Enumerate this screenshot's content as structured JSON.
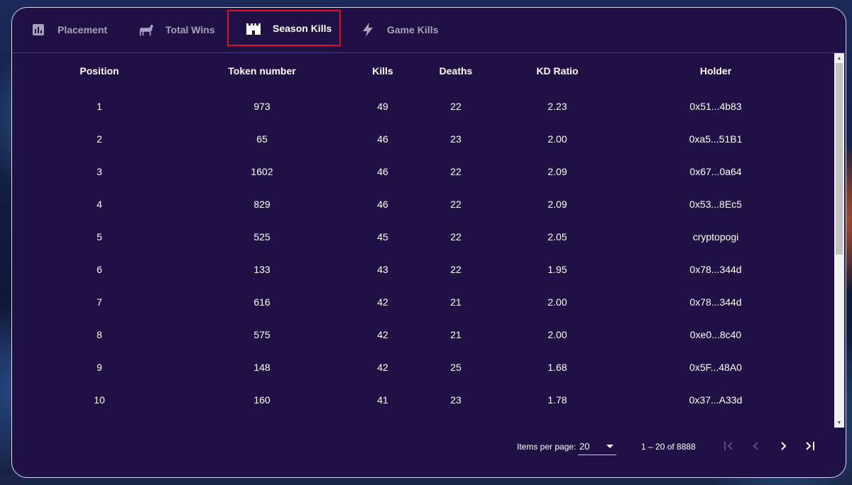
{
  "tabs": [
    {
      "label": "Placement",
      "icon": "bar-chart-icon"
    },
    {
      "label": "Total Wins",
      "icon": "goat-icon"
    },
    {
      "label": "Season Kills",
      "icon": "castle-icon"
    },
    {
      "label": "Game Kills",
      "icon": "lightning-icon"
    }
  ],
  "active_tab": "Season Kills",
  "highlight_color": "#e0101c",
  "table": {
    "headers": [
      "Position",
      "Token number",
      "Kills",
      "Deaths",
      "KD Ratio",
      "Holder"
    ],
    "rows": [
      [
        "1",
        "973",
        "49",
        "22",
        "2.23",
        "0x51...4b83"
      ],
      [
        "2",
        "65",
        "46",
        "23",
        "2.00",
        "0xa5...51B1"
      ],
      [
        "3",
        "1602",
        "46",
        "22",
        "2.09",
        "0x67...0a64"
      ],
      [
        "4",
        "829",
        "46",
        "22",
        "2.09",
        "0x53...8Ec5"
      ],
      [
        "5",
        "525",
        "45",
        "22",
        "2.05",
        "cryptopogi"
      ],
      [
        "6",
        "133",
        "43",
        "22",
        "1.95",
        "0x78...344d"
      ],
      [
        "7",
        "616",
        "42",
        "21",
        "2.00",
        "0x78...344d"
      ],
      [
        "8",
        "575",
        "42",
        "21",
        "2.00",
        "0xe0...8c40"
      ],
      [
        "9",
        "148",
        "42",
        "25",
        "1.68",
        "0x5F...48A0"
      ],
      [
        "10",
        "160",
        "41",
        "23",
        "1.78",
        "0x37...A33d"
      ]
    ]
  },
  "paginator": {
    "items_per_page_label": "Items per page:",
    "items_per_page_value": "20",
    "range_label": "1 – 20 of 8888"
  }
}
